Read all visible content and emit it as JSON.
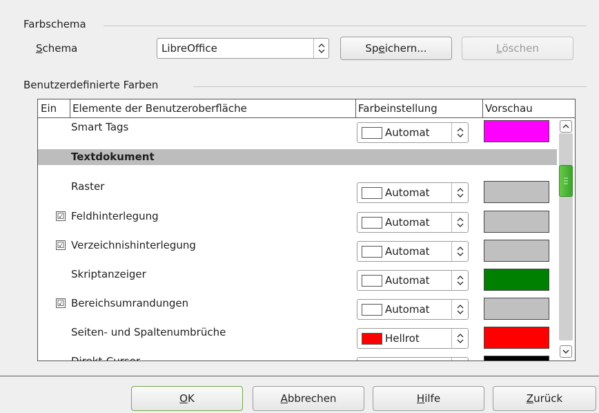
{
  "color_scheme": {
    "section_title": "Farbschema",
    "scheme_label": "Schema",
    "scheme_label_key": "S",
    "scheme_label_rest": "chema",
    "scheme_value": "LibreOffice",
    "save_button_pre": "Sp",
    "save_button_key": "e",
    "save_button_post": "ichern...",
    "delete_button_key": "L",
    "delete_button_rest": "öschen"
  },
  "custom_colors": {
    "section_title": "Benutzerdefinierte Farben",
    "columns": {
      "on": "Ein",
      "elements": "Elemente der Benutzeroberfläche",
      "color_setting": "Farbeinstellung",
      "preview": "Vorschau"
    },
    "rows": [
      {
        "label": "Smart Tags",
        "checkbox": false,
        "color_label": "Automat",
        "swatch": "#ffffff",
        "preview": "#ff00ff"
      },
      {
        "label": "Textdokument",
        "category": true
      },
      {
        "label": "Raster",
        "checkbox": false,
        "color_label": "Automat",
        "swatch": "#ffffff",
        "preview": "#c0c0c0"
      },
      {
        "label": "Feldhinterlegung",
        "checkbox": true,
        "checked": "☑",
        "color_label": "Automat",
        "swatch": "#ffffff",
        "preview": "#c0c0c0"
      },
      {
        "label": "Verzeichnishinterlegung",
        "checkbox": true,
        "checked": "☑",
        "color_label": "Automat",
        "swatch": "#ffffff",
        "preview": "#c0c0c0"
      },
      {
        "label": "Skriptanzeiger",
        "checkbox": false,
        "color_label": "Automat",
        "swatch": "#ffffff",
        "preview": "#008000"
      },
      {
        "label": "Bereichsumrandungen",
        "checkbox": true,
        "checked": "☑",
        "color_label": "Automat",
        "swatch": "#ffffff",
        "preview": "#c0c0c0"
      },
      {
        "label": "Seiten- und Spaltenumbrüche",
        "checkbox": false,
        "color_label": "Hellrot",
        "swatch": "#ff0000",
        "preview": "#ff0000"
      },
      {
        "label": "Direkt-Cursor",
        "checkbox": false,
        "color_label": "",
        "swatch": "#ffffff",
        "preview": "#000000"
      }
    ]
  },
  "buttons": {
    "ok_key": "O",
    "ok_rest": "K",
    "cancel_key": "A",
    "cancel_rest": "bbrechen",
    "help_key": "H",
    "help_rest": "ilfe",
    "back_key": "Z",
    "back_rest": "urück"
  },
  "colors": {
    "default_button_border": "#74a84a",
    "scroll_thumb": "#4fb83a",
    "category_background": "#bdbdbd"
  }
}
